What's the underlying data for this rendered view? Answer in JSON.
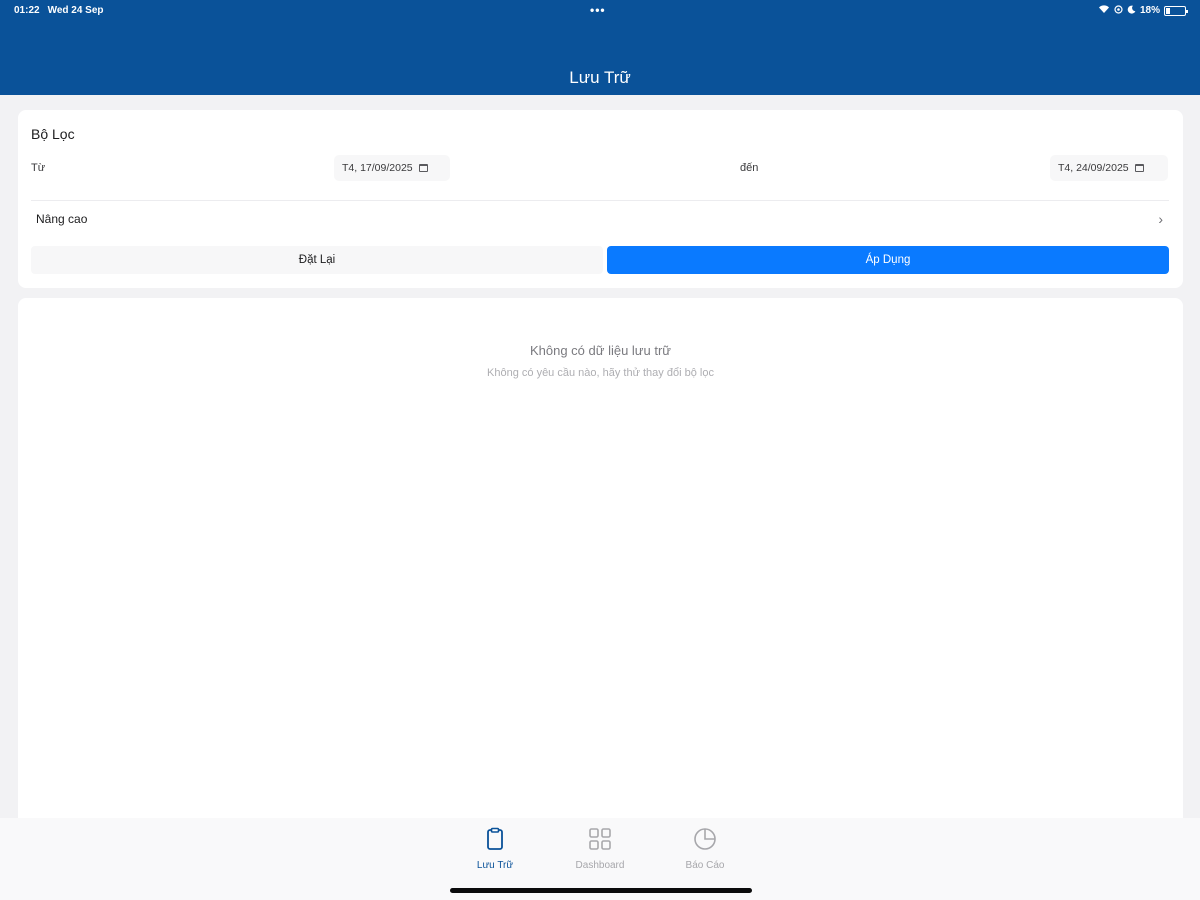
{
  "status_bar": {
    "time": "01:22",
    "date": "Wed 24 Sep",
    "battery": "18%"
  },
  "header": {
    "title": "Lưu Trữ",
    "background_color": "#0a5299"
  },
  "filter": {
    "title": "Bộ Lọc",
    "from_label": "Từ",
    "from_value": "T4, 17/09/2025",
    "to_label": "đến",
    "to_value": "T4, 24/09/2025",
    "advanced_label": "Nâng cao",
    "reset_label": "Đặt Lại",
    "apply_label": "Áp Dụng",
    "apply_color": "#0a7aff"
  },
  "empty_state": {
    "title": "Không có dữ liệu lưu trữ",
    "subtitle": "Không có yêu cầu nào, hãy thử thay đổi bộ lọc"
  },
  "tabs": [
    {
      "label": "Lưu Trữ",
      "icon": "clipboard-icon",
      "active": true
    },
    {
      "label": "Dashboard",
      "icon": "grid-icon",
      "active": false
    },
    {
      "label": "Báo Cáo",
      "icon": "pie-chart-icon",
      "active": false
    }
  ]
}
